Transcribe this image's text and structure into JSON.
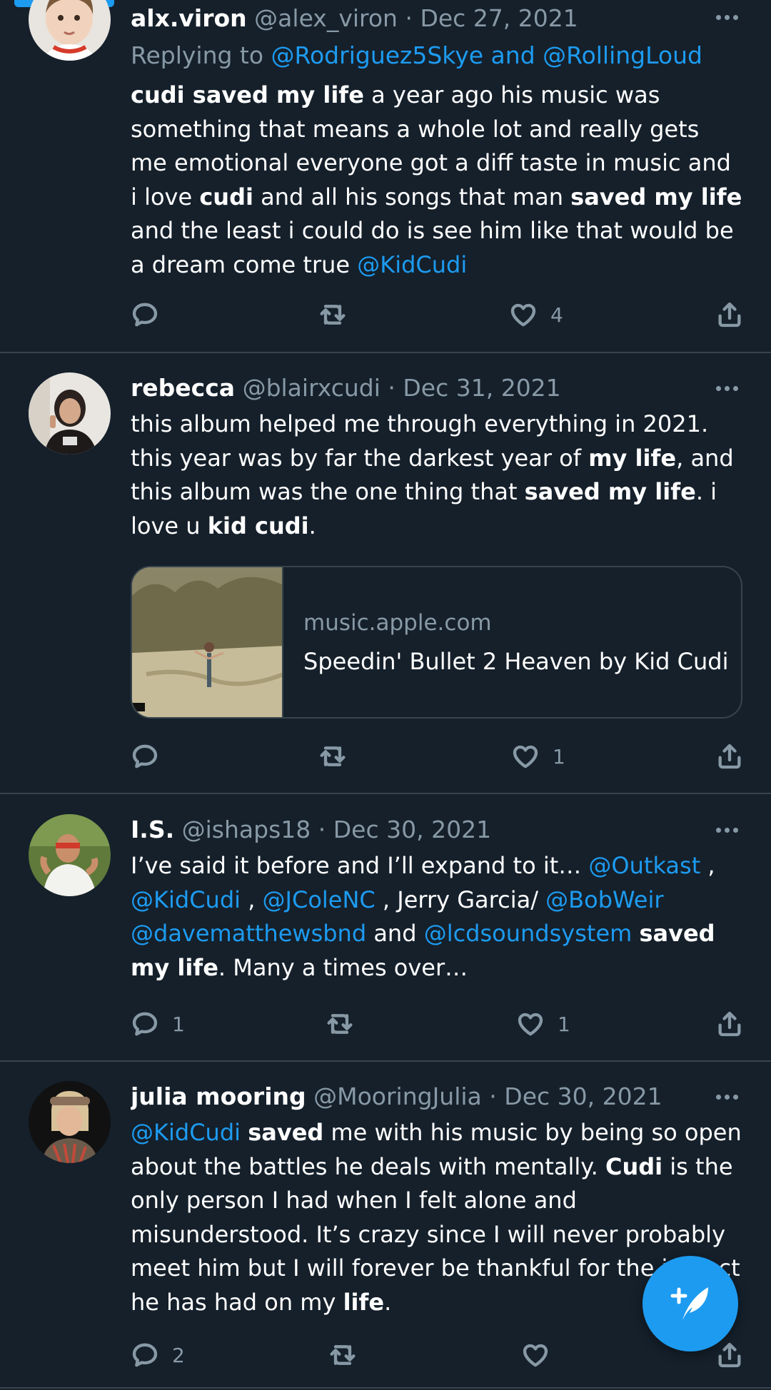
{
  "tweets": [
    {
      "name": "alx.viron",
      "handle": "@alex_viron",
      "date": "Dec 27, 2021",
      "reply_prefix": "Replying to",
      "reply_handles": "@Rodriguez5Skye and @RollingLoud",
      "segments": [
        {
          "t": "cudi saved my life",
          "s": "b"
        },
        {
          "t": " a year ago his music was something that means a whole lot and really gets me emotional everyone got a diff taste in music and i love ",
          "s": "n"
        },
        {
          "t": "cudi",
          "s": "b"
        },
        {
          "t": " and all his songs that man ",
          "s": "n"
        },
        {
          "t": "saved my life",
          "s": "b"
        },
        {
          "t": " and the least i could do is see him like that would be a dream come true ",
          "s": "n"
        },
        {
          "t": "@KidCudi",
          "s": "m"
        }
      ],
      "replies": "",
      "retweets": "",
      "likes": "4"
    },
    {
      "name": "rebecca",
      "handle": "@blairxcudi",
      "date": "Dec 31, 2021",
      "segments": [
        {
          "t": "this album helped me through everything in 2021. this year was by far the darkest year of ",
          "s": "n"
        },
        {
          "t": "my life",
          "s": "b"
        },
        {
          "t": ", and this album was the one thing that ",
          "s": "n"
        },
        {
          "t": "saved my life",
          "s": "b"
        },
        {
          "t": ". i love u ",
          "s": "n"
        },
        {
          "t": "kid cudi",
          "s": "b"
        },
        {
          "t": ".",
          "s": "n"
        }
      ],
      "card": {
        "domain": "music.apple.com",
        "title": "Speedin' Bullet 2 Heaven by Kid Cudi"
      },
      "replies": "",
      "retweets": "",
      "likes": "1"
    },
    {
      "name": "I.S.",
      "handle": "@ishaps18",
      "date": "Dec 30, 2021",
      "segments": [
        {
          "t": "I’ve said it before and I’ll expand to it… ",
          "s": "n"
        },
        {
          "t": "@Outkast",
          "s": "m"
        },
        {
          "t": " , ",
          "s": "n"
        },
        {
          "t": "@KidCudi",
          "s": "m"
        },
        {
          "t": " , ",
          "s": "n"
        },
        {
          "t": "@JColeNC",
          "s": "m"
        },
        {
          "t": "  , Jerry Garcia/ ",
          "s": "n"
        },
        {
          "t": "@BobWeir",
          "s": "m"
        },
        {
          "t": " ",
          "s": "n"
        },
        {
          "t": "@davematthewsbnd",
          "s": "m"
        },
        {
          "t": "  and ",
          "s": "n"
        },
        {
          "t": "@lcdsoundsystem",
          "s": "m"
        },
        {
          "t": " ",
          "s": "n"
        },
        {
          "t": "saved my life",
          "s": "b"
        },
        {
          "t": ". Many a times over…",
          "s": "n"
        }
      ],
      "replies": "1",
      "retweets": "",
      "likes": "1"
    },
    {
      "name": "julia mooring",
      "handle": "@MooringJulia",
      "date": "Dec 30, 2021",
      "segments": [
        {
          "t": "@KidCudi",
          "s": "m"
        },
        {
          "t": " ",
          "s": "n"
        },
        {
          "t": "saved",
          "s": "b"
        },
        {
          "t": " me with his music  by being so open about the battles he deals with mentally. ",
          "s": "n"
        },
        {
          "t": "Cudi",
          "s": "b"
        },
        {
          "t": " is the only person I had when I felt alone and misunderstood. It’s crazy since I will never probably meet him but I will forever be thankful for the impact he has had on my ",
          "s": "n"
        },
        {
          "t": "life",
          "s": "b"
        },
        {
          "t": ".",
          "s": "n"
        }
      ],
      "replies": "2",
      "retweets": "",
      "likes": ""
    }
  ],
  "separator": "·",
  "icons": {
    "reply": "reply-icon",
    "retweet": "retweet-icon",
    "like": "heart-icon",
    "share": "share-icon",
    "more": "more-icon",
    "compose": "compose-tweet-icon"
  },
  "colors": {
    "background": "#15202b",
    "accent": "#1d9bf0",
    "muted": "#8899a6",
    "divider": "#38444d"
  }
}
